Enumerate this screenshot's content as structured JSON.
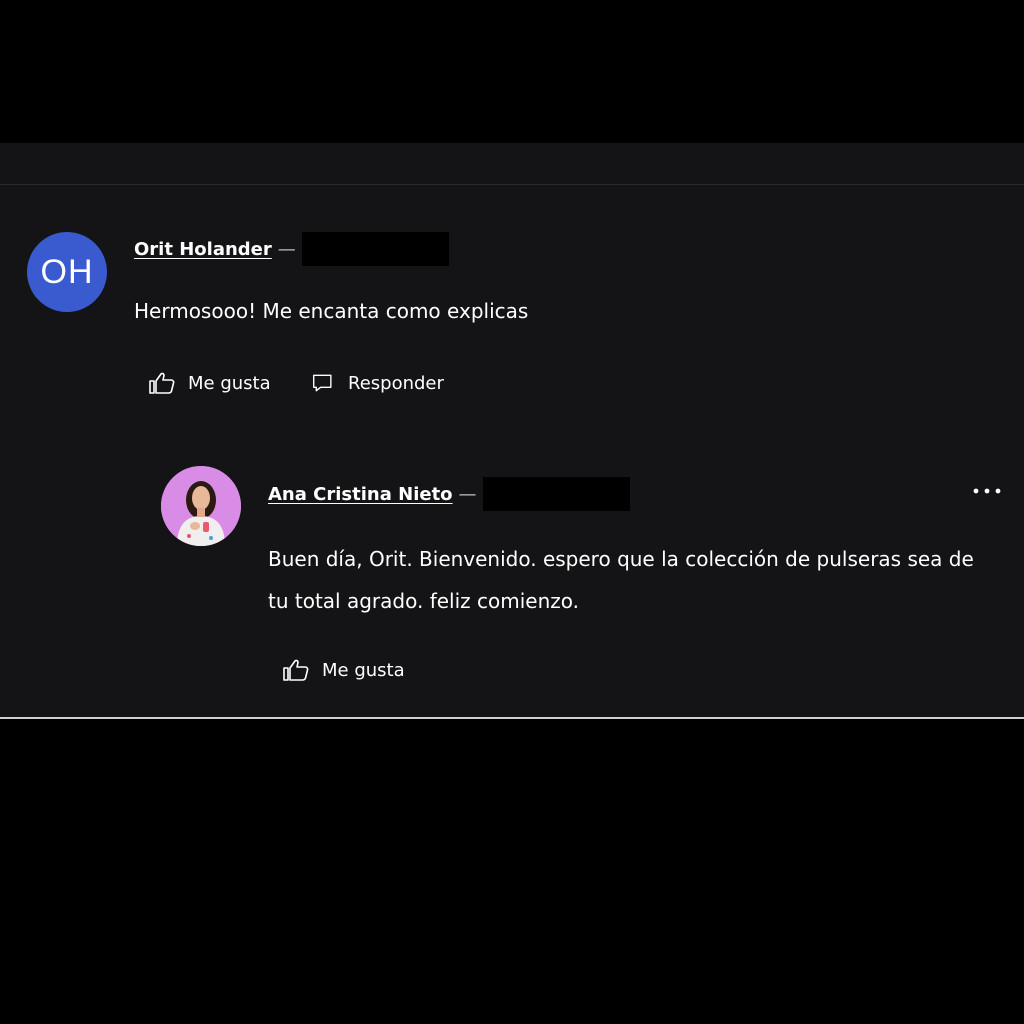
{
  "comments": [
    {
      "author": "Orit Holander",
      "initials": "OH",
      "separator": "—",
      "text": "Hermosooo! Me encanta como explicas",
      "like_label": "Me gusta",
      "reply_label": "Responder",
      "avatar_color": "#3a5bd0"
    }
  ],
  "reply": {
    "author": "Ana Cristina Nieto",
    "separator": "—",
    "text_line1": "Buen día, Orit. Bienvenido. espero que la colección de pulseras sea de",
    "text_line2": "tu total agrado. feliz comienzo.",
    "like_label": "Me gusta",
    "more_icon": "more-horizontal-icon",
    "avatar_color": "#d88ce6"
  },
  "icons": {
    "like": "thumbs-up-icon",
    "reply": "speech-bubble-icon"
  },
  "colors": {
    "background": "#000000",
    "panel": "#141416",
    "text": "#ffffff"
  }
}
